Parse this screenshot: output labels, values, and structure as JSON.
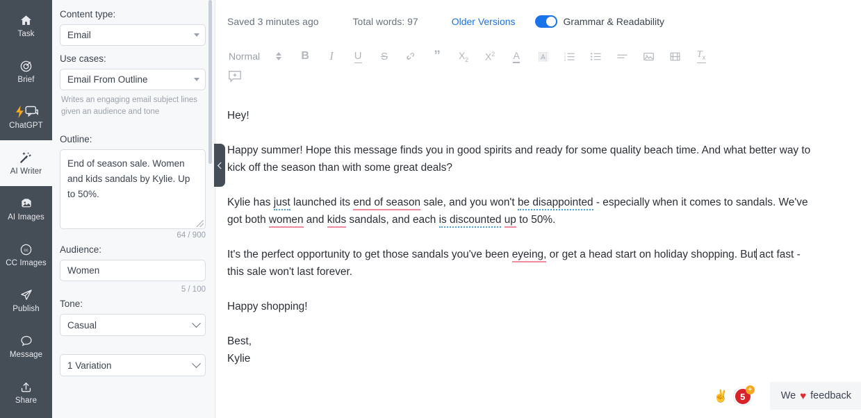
{
  "rail": {
    "items": [
      {
        "label": "Task",
        "icon": "home-icon",
        "active": false
      },
      {
        "label": "Brief",
        "icon": "target-icon",
        "active": false
      },
      {
        "label": "ChatGPT",
        "icon": "chatgpt-bolt-icon",
        "active": false
      },
      {
        "label": "AI Writer",
        "icon": "magic-wand-icon",
        "active": true
      },
      {
        "label": "AI Images",
        "icon": "image-icon",
        "active": false
      },
      {
        "label": "CC Images",
        "icon": "creative-commons-icon",
        "active": false
      },
      {
        "label": "Publish",
        "icon": "paper-plane-icon",
        "active": false
      },
      {
        "label": "Message",
        "icon": "chat-bubble-icon",
        "active": false
      },
      {
        "label": "Share",
        "icon": "share-upload-icon",
        "active": false
      }
    ]
  },
  "panel": {
    "content_type": {
      "label": "Content type:",
      "value": "Email"
    },
    "use_cases": {
      "label": "Use cases:",
      "value": "Email From Outline",
      "hint": "Writes an engaging email subject lines given an audience and tone"
    },
    "outline": {
      "label": "Outline:",
      "value": "End of season sale. Women and kids sandals by Kylie. Up to 50%.",
      "counter": "64 / 900"
    },
    "audience": {
      "label": "Audience:",
      "value": "Women",
      "counter": "5 / 100"
    },
    "tone": {
      "label": "Tone:",
      "value": "Casual"
    },
    "variations": {
      "value": "1 Variation"
    },
    "collapse_handle": "chevron-left-icon"
  },
  "topbar": {
    "saved": "Saved 3 minutes ago",
    "total_words": "Total words: 97",
    "older_versions": "Older Versions",
    "grammar_toggle_label": "Grammar & Readability",
    "grammar_toggle_on": true,
    "accent_blue": "#1a73e8"
  },
  "toolbar": {
    "style_value": "Normal",
    "buttons": [
      {
        "name": "style-dropdown-icon",
        "glyph": "updown"
      },
      {
        "name": "bold-button",
        "glyph": "B"
      },
      {
        "name": "italic-button",
        "glyph": "I"
      },
      {
        "name": "underline-button",
        "glyph": "U"
      },
      {
        "name": "strikethrough-button",
        "glyph": "S"
      },
      {
        "name": "link-button",
        "glyph": "link"
      },
      {
        "name": "blockquote-button",
        "glyph": "”"
      },
      {
        "name": "subscript-button",
        "glyph": "X2sub"
      },
      {
        "name": "superscript-button",
        "glyph": "X2sup"
      },
      {
        "name": "text-color-button",
        "glyph": "A-underline"
      },
      {
        "name": "highlight-color-button",
        "glyph": "A-shaded"
      },
      {
        "name": "ordered-list-button",
        "glyph": "ol"
      },
      {
        "name": "unordered-list-button",
        "glyph": "ul"
      },
      {
        "name": "align-button",
        "glyph": "align"
      },
      {
        "name": "insert-image-button",
        "glyph": "image"
      },
      {
        "name": "insert-video-button",
        "glyph": "video"
      },
      {
        "name": "clear-format-button",
        "glyph": "Tx"
      }
    ],
    "comment_button": "add-comment-icon"
  },
  "document": {
    "paragraphs": [
      {
        "id": "greeting",
        "runs": [
          {
            "t": "Hey!"
          }
        ]
      },
      {
        "id": "intro",
        "runs": [
          {
            "t": "Happy summer! Hope this message finds you in good spirits and ready for some quality beach time. And what better way to kick off the season than with some great deals?"
          }
        ]
      },
      {
        "id": "body-1",
        "runs": [
          {
            "t": "Kylie has "
          },
          {
            "t": "just",
            "mark": "blue"
          },
          {
            "t": " launched its "
          },
          {
            "t": "end of season",
            "mark": "pink"
          },
          {
            "t": " sale, and you won't "
          },
          {
            "t": "be disappointed",
            "mark": "blue"
          },
          {
            "t": " - especially when it comes to sandals. We've got both "
          },
          {
            "t": "women",
            "mark": "pink"
          },
          {
            "t": " and "
          },
          {
            "t": "kids",
            "mark": "pink"
          },
          {
            "t": " sandals, and each "
          },
          {
            "t": "is discounted",
            "mark": "blue"
          },
          {
            "t": " "
          },
          {
            "t": "up",
            "mark": "pink"
          },
          {
            "t": " to 50%."
          }
        ]
      },
      {
        "id": "body-2",
        "runs": [
          {
            "t": "It's the perfect opportunity to get those sandals you've been "
          },
          {
            "t": "eyeing,",
            "mark": "pink"
          },
          {
            "t": " or get a head start on holiday shopping. But"
          },
          {
            "t": "",
            "caret": true
          },
          {
            "t": " act fast - this sale won't last forever."
          }
        ]
      },
      {
        "id": "closing",
        "runs": [
          {
            "t": "Happy shopping!"
          }
        ]
      },
      {
        "id": "signoff-1",
        "runs": [
          {
            "t": "Best,"
          }
        ],
        "tight": true
      },
      {
        "id": "signoff-2",
        "runs": [
          {
            "t": "Kylie"
          }
        ]
      }
    ],
    "mark_colors": {
      "pink": "#f08a9e",
      "blue": "#4a9fe0"
    }
  },
  "bottom_right": {
    "peace_emoji": "✌",
    "notification_count": "5",
    "notification_plus": "+",
    "notification_color": "#d8232a",
    "plus_badge_color": "#f5a623",
    "feedback_pre": "We",
    "feedback_heart": "♥",
    "feedback_post": "feedback"
  }
}
